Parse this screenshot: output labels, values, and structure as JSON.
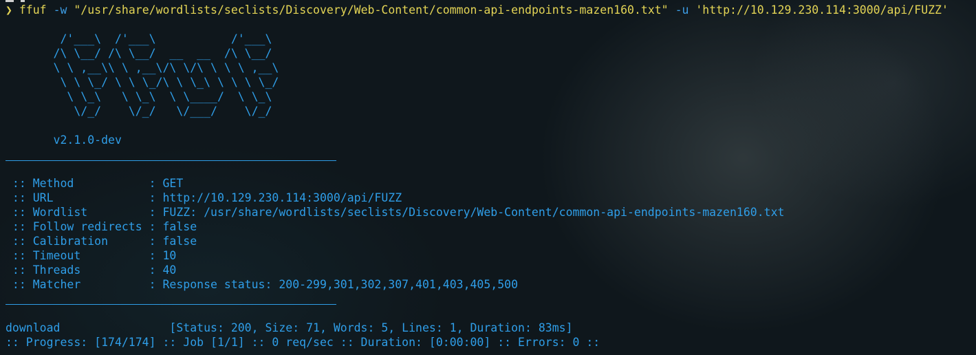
{
  "command": {
    "prompt_symbol": "❯",
    "program": "ffuf",
    "flag_w": "-w",
    "wordlist_arg": "\"/usr/share/wordlists/seclists/Discovery/Web-Content/common-api-endpoints-mazen160.txt\"",
    "flag_u": "-u",
    "url_arg": "'http://10.129.230.114:3000/api/FUZZ'"
  },
  "banner": {
    "lines": [
      "        /'___\\  /'___\\           /'___\\",
      "       /\\ \\__/ /\\ \\__/  __  __  /\\ \\__/",
      "       \\ \\ ,__\\\\ \\ ,__\\/\\ \\/\\ \\ \\ \\ ,__\\",
      "        \\ \\ \\_/ \\ \\ \\_/\\ \\ \\_\\ \\ \\ \\ \\_/",
      "         \\ \\_\\   \\ \\_\\  \\ \\____/  \\ \\_\\",
      "          \\/_/    \\/_/   \\/___/    \\/_/"
    ],
    "version": "       v2.1.0-dev"
  },
  "config": [
    " :: Method           : GET",
    " :: URL              : http://10.129.230.114:3000/api/FUZZ",
    " :: Wordlist         : FUZZ: /usr/share/wordlists/seclists/Discovery/Web-Content/common-api-endpoints-mazen160.txt",
    " :: Follow redirects : false",
    " :: Calibration      : false",
    " :: Timeout          : 10",
    " :: Threads          : 40",
    " :: Matcher          : Response status: 200-299,301,302,307,401,403,405,500"
  ],
  "result": {
    "line": "download                [Status: 200, Size: 71, Words: 5, Lines: 1, Duration: 83ms]"
  },
  "progress": {
    "line": ":: Progress: [174/174] :: Job [1/1] :: 0 req/sec :: Duration: [0:00:00] :: Errors: 0 ::"
  },
  "colors": {
    "background": "#0f171c",
    "accent_blue": "#2f9ee8",
    "command_yellow": "#e3d455"
  }
}
